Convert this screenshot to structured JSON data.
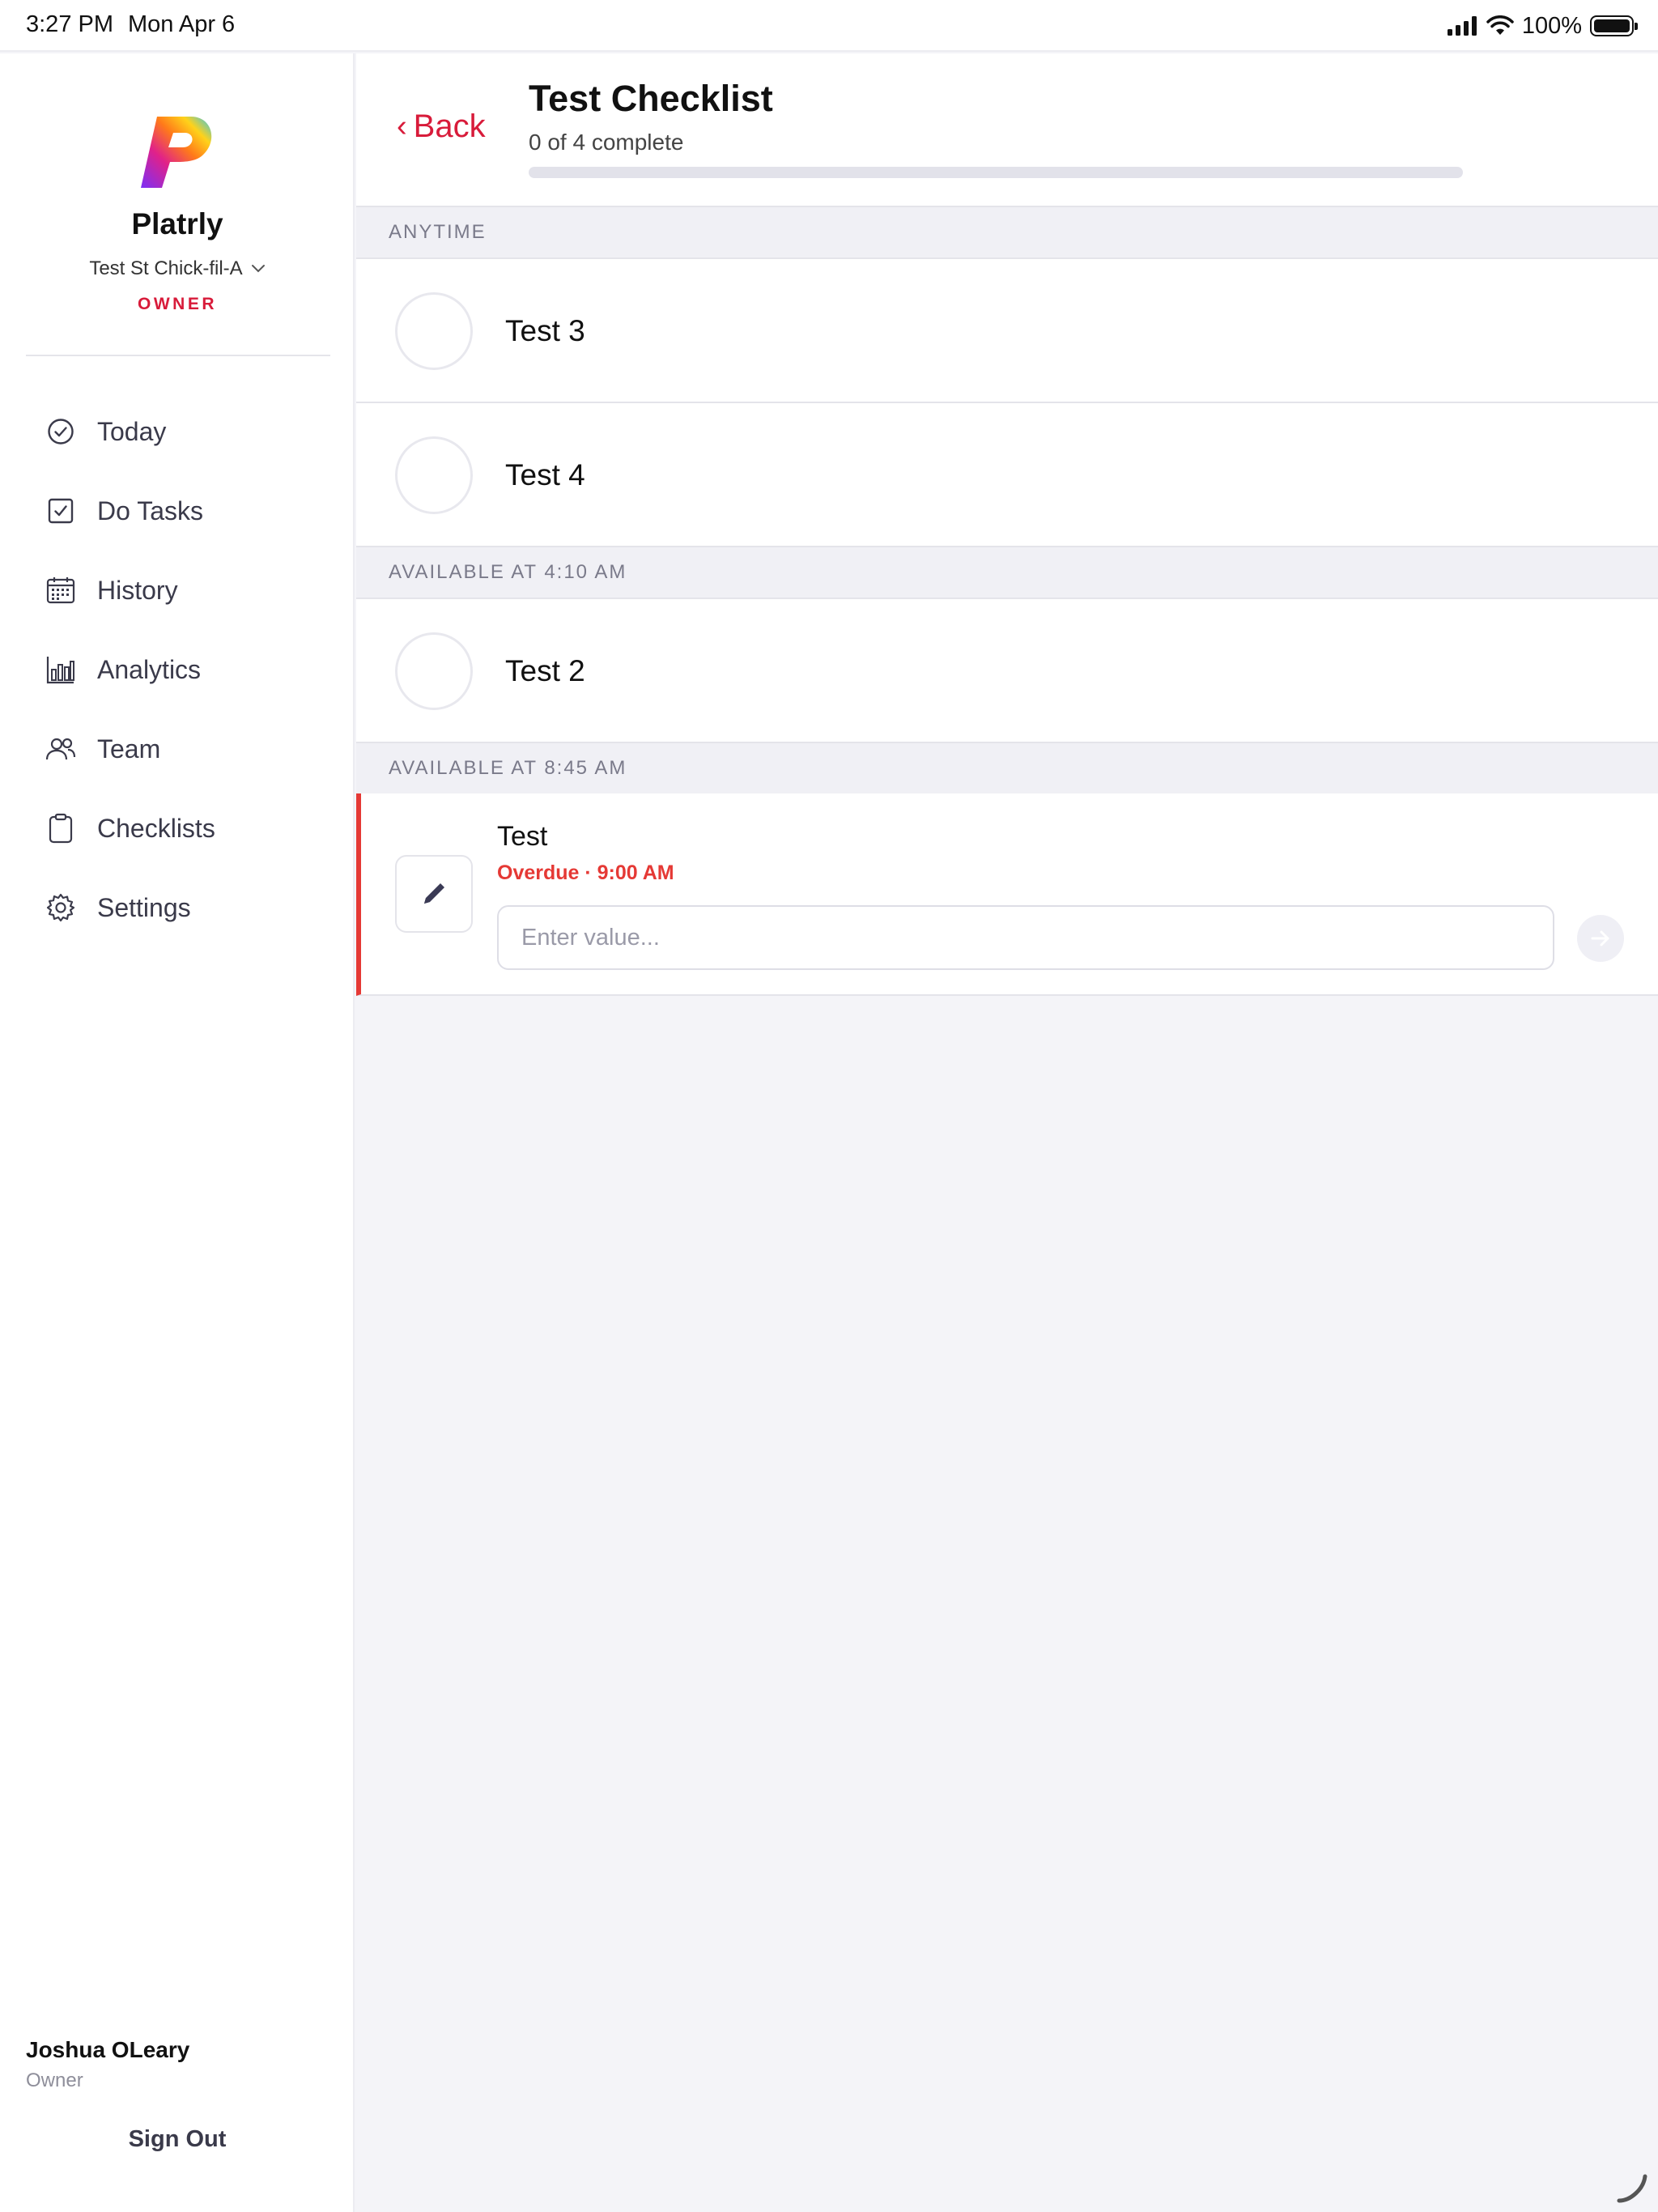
{
  "status_bar": {
    "time": "3:27 PM",
    "date": "Mon Apr 6",
    "battery": "100%",
    "icons": [
      "cellular-signal-icon",
      "wifi-icon",
      "battery-icon"
    ]
  },
  "sidebar": {
    "brand": "Platrly",
    "store": "Test St Chick-fil-A",
    "role": "OWNER",
    "items": [
      {
        "label": "Today",
        "icon": "check-circle-icon"
      },
      {
        "label": "Do Tasks",
        "icon": "checkbox-icon"
      },
      {
        "label": "History",
        "icon": "calendar-icon"
      },
      {
        "label": "Analytics",
        "icon": "bar-chart-icon"
      },
      {
        "label": "Team",
        "icon": "people-icon"
      },
      {
        "label": "Checklists",
        "icon": "clipboard-icon"
      },
      {
        "label": "Settings",
        "icon": "gear-icon"
      }
    ],
    "user": {
      "name": "Joshua OLeary",
      "role": "Owner"
    },
    "sign_out": "Sign Out"
  },
  "header": {
    "back_label": "Back",
    "back_chevron": "‹",
    "title": "Test Checklist",
    "subtitle": "0 of 4 complete",
    "progress_fraction": 0
  },
  "sections": [
    {
      "title": "ANYTIME",
      "tasks": [
        {
          "name": "Test 3"
        },
        {
          "name": "Test 4"
        }
      ]
    },
    {
      "title": "AVAILABLE AT 4:10 AM",
      "tasks": [
        {
          "name": "Test 2"
        }
      ]
    },
    {
      "title": "AVAILABLE AT 8:45 AM",
      "tasks": [
        {
          "name": "Test",
          "status": "Overdue · 9:00 AM",
          "input_placeholder": "Enter value...",
          "input_value": ""
        }
      ]
    }
  ],
  "colors": {
    "accent": "#d81b3a",
    "overdue": "#e53935",
    "background": "#f4f4f8",
    "text": "#111111"
  }
}
